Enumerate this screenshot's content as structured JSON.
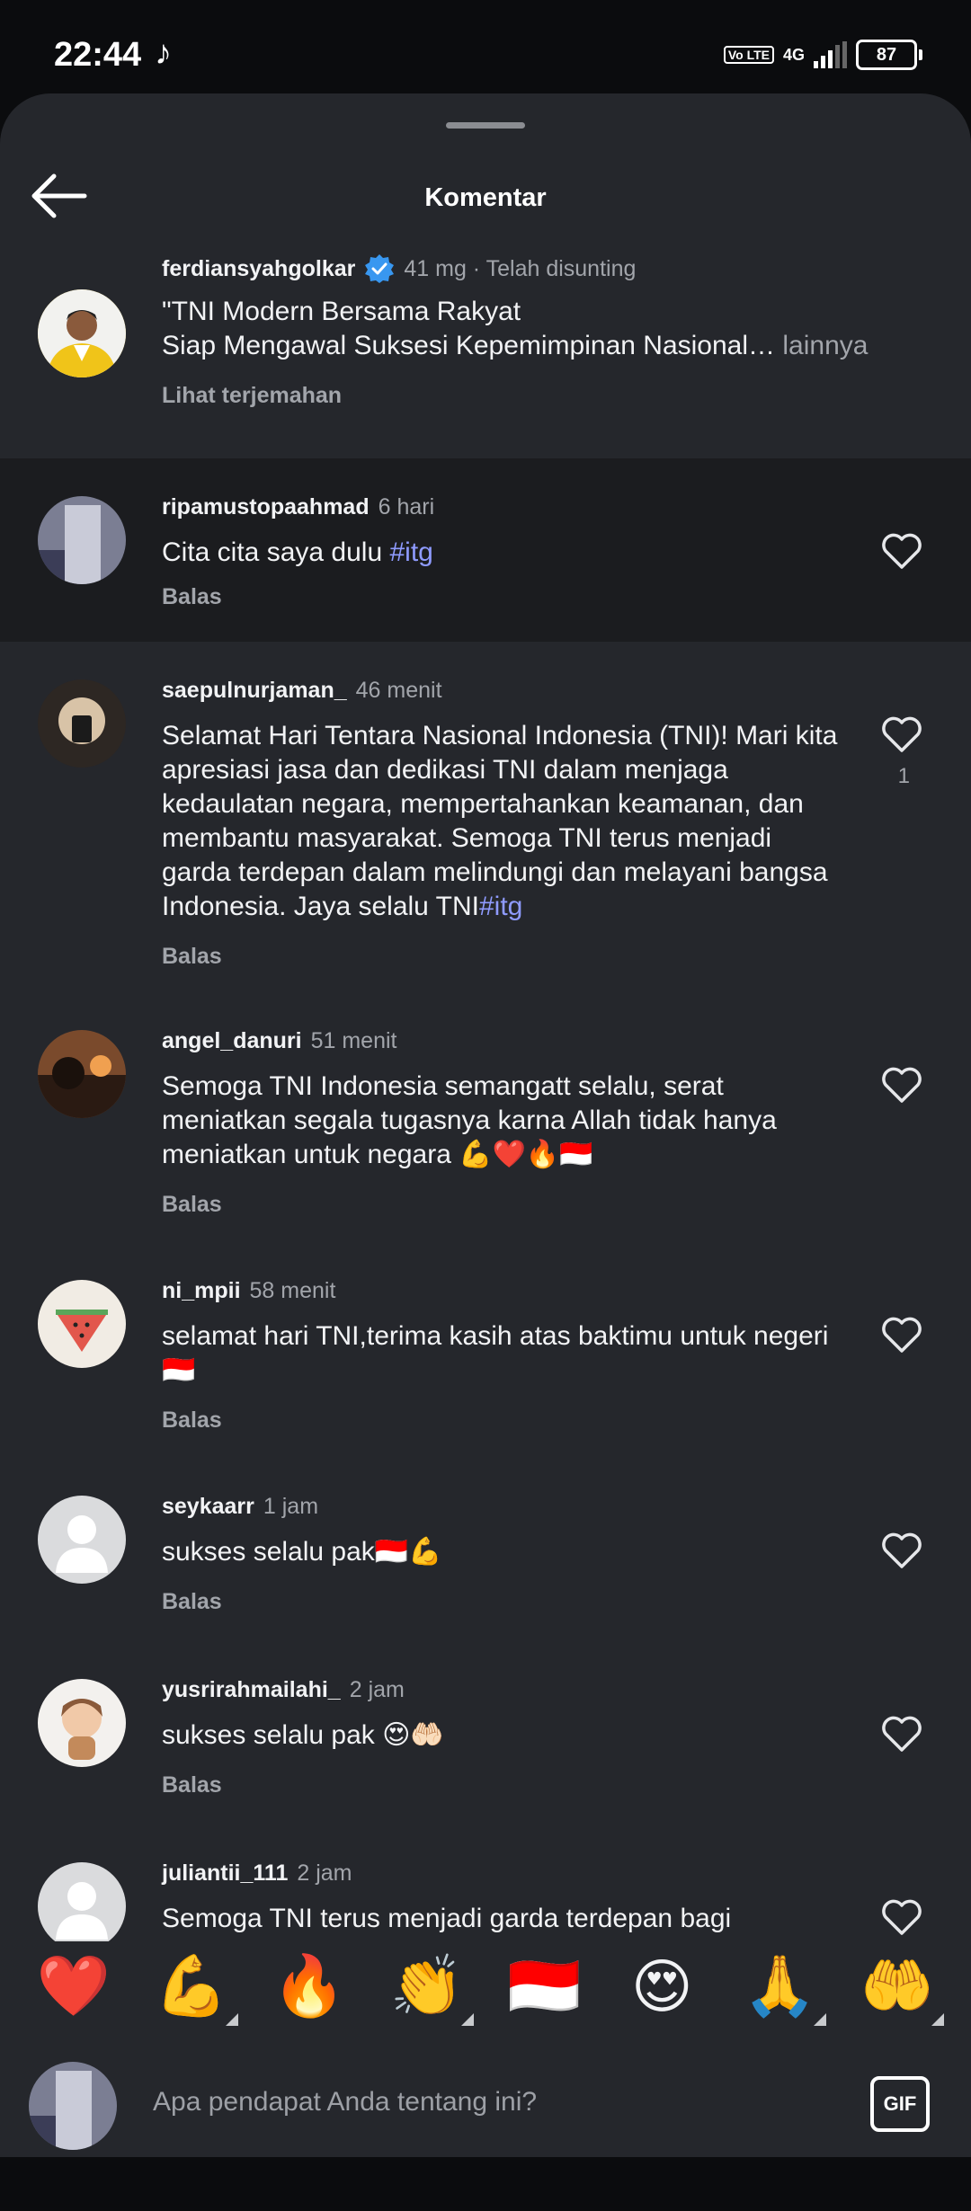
{
  "status": {
    "time": "22:44",
    "volte": "Vo LTE",
    "network": "4G",
    "battery": "87"
  },
  "header": {
    "title": "Komentar"
  },
  "caption": {
    "username": "ferdiansyahgolkar",
    "meta": "41 mg · Telah disunting",
    "line1": "\"TNI Modern Bersama Rakyat",
    "line2": "Siap Mengawal Suksesi Kepemimpinan Nasional…",
    "more": "lainnya",
    "translate": "Lihat terjemahan"
  },
  "comments": [
    {
      "username": "ripamustopaahmad",
      "time": "6 hari",
      "text": "Cita cita saya dulu ",
      "hashtag": "#itg",
      "reply": "Balas"
    },
    {
      "username": "saepulnurjaman_",
      "time": "46 menit",
      "text": "Selamat Hari Tentara Nasional Indonesia (TNI)! Mari kita apresiasi jasa dan dedikasi TNI dalam menjaga kedaulatan negara, mempertahankan keamanan, dan membantu masyarakat. Semoga TNI terus menjadi garda terdepan dalam melindungi dan melayani bangsa Indonesia. Jaya selalu TNI",
      "hashtag": "#itg",
      "reply": "Balas",
      "likes": "1"
    },
    {
      "username": "angel_danuri",
      "time": "51 menit",
      "text": "Semoga TNI Indonesia semangatt selalu, serat meniatkan segala tugasnya karna Allah tidak hanya meniatkan untuk negara 💪❤️🔥🇮🇩",
      "reply": "Balas"
    },
    {
      "username": "ni_mpii",
      "time": "58 menit",
      "text": "selamat hari TNI,terima kasih atas baktimu untuk negeri🇮🇩",
      "reply": "Balas"
    },
    {
      "username": "seykaarr",
      "time": "1 jam",
      "text": "sukses selalu pak🇮🇩💪",
      "reply": "Balas"
    },
    {
      "username": "yusrirahmailahi_",
      "time": "2 jam",
      "text": "sukses selalu pak 😍🤲🏻",
      "reply": "Balas"
    },
    {
      "username": "juliantii_111",
      "time": "2 jam",
      "text": "Semoga TNI terus menjadi garda terdepan bagi"
    }
  ],
  "emoji_bar": [
    "❤️",
    "💪",
    "🔥",
    "👏",
    "🇮🇩",
    "😍",
    "🙏",
    "🤲"
  ],
  "composer": {
    "placeholder": "Apa pendapat Anda tentang ini?",
    "gif_label": "GIF"
  },
  "colors": {
    "sheet": "#25272c",
    "highlight": "#1b1c1f",
    "hashtag": "#8f9bff",
    "verified": "#3897f0"
  },
  "icons": [
    "back-arrow-icon",
    "verified-badge-icon",
    "heart-icon",
    "gif-icon",
    "tiktok-icon"
  ]
}
